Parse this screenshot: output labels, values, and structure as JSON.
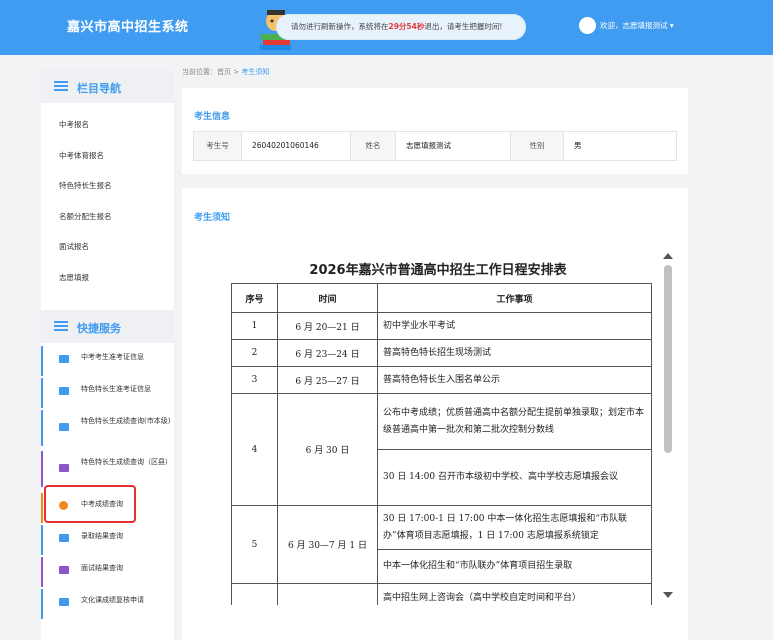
{
  "header": {
    "site_title": "嘉兴市高中招生系统",
    "notice_prefix": "请勿进行刷新操作，系统将在",
    "notice_time": "29分54秒",
    "notice_suffix": "退出，请考生把握时间!",
    "user_text": "欢迎，志愿填报测试 ▾"
  },
  "sidebar": {
    "nav_title": "栏目导航",
    "nav_items": [
      "中考报名",
      "中考体育报名",
      "特色特长生报名",
      "名额分配生报名",
      "面试报名",
      "志愿填报"
    ],
    "services_title": "快捷服务",
    "service_items": [
      "中考考生准考证信息",
      "特色特长生准考证信息",
      "特色特长生成绩查询(市本级)",
      "特色特长生成绩查询（区县）",
      "中考成绩查询",
      "录取结果查询",
      "面试结果查询",
      "文化课成绩复核申请"
    ]
  },
  "breadcrumb": {
    "prefix": "当前位置：",
    "home": "首页",
    "sep": ">",
    "current": "考生须知"
  },
  "student_info": {
    "title": "考生信息",
    "id_label": "考生号",
    "id_value": "26040201060146",
    "name_label": "姓名",
    "name_value": "志愿填报测试",
    "gender_label": "性别",
    "gender_value": "男"
  },
  "notice": {
    "title": "考生须知",
    "doc_title": "2026年嘉兴市普通高中招生工作日程安排表",
    "headers": [
      "序号",
      "时间",
      "工作事项"
    ],
    "rows": [
      {
        "no": "1",
        "time": "6 月 20—21 日",
        "items": [
          "初中学业水平考试"
        ]
      },
      {
        "no": "2",
        "time": "6 月 23—24 日",
        "items": [
          "普高特色特长招生现场测试"
        ]
      },
      {
        "no": "3",
        "time": "6 月 25—27 日",
        "items": [
          "普高特色特长生入围名单公示"
        ]
      },
      {
        "no": "4",
        "time": "6 月 30 日",
        "items": [
          "公布中考成绩；优质普通高中名额分配生提前单独录取；划定市本级普通高中第一批次和第二批次控制分数线",
          "30 日 14:00 召开市本级初中学校、高中学校志愿填报会议"
        ]
      },
      {
        "no": "5",
        "time": "6 月 30—7 月 1 日",
        "items": [
          "30 日 17:00-1 日 17:00 中本一体化招生志愿填报和“市队联办”体育项目志愿填报，1 日 17:00 志愿填报系统锁定",
          "中本一体化招生和“市队联办”体育项目招生录取"
        ]
      },
      {
        "no": "",
        "time": "",
        "items": [
          "高中招生网上咨询会（高中学校自定时间和平台）"
        ]
      }
    ]
  },
  "colors": {
    "header_bg": "#3f9cf0",
    "accent": "#3f9cf0",
    "countdown": "#e63b3b",
    "highlight_border": "#e53030"
  }
}
